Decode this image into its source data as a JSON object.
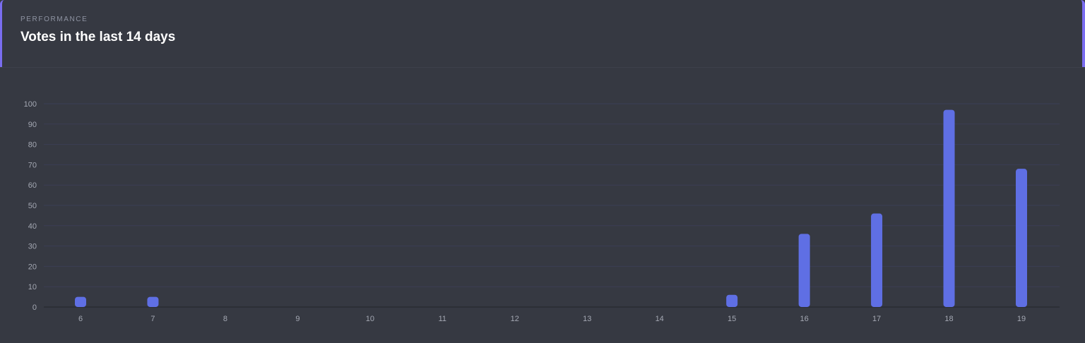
{
  "header": {
    "eyebrow": "PERFORMANCE",
    "title": "Votes in the last 14 days"
  },
  "colors": {
    "accent": "#7a6df0",
    "bar": "#5f6fe4",
    "grid": "#3b3e55",
    "card": "#363942"
  },
  "chart_data": {
    "type": "bar",
    "title": "Votes in the last 14 days",
    "xlabel": "",
    "ylabel": "",
    "categories": [
      "6",
      "7",
      "8",
      "9",
      "10",
      "11",
      "12",
      "13",
      "14",
      "15",
      "16",
      "17",
      "18",
      "19"
    ],
    "values": [
      5,
      5,
      0,
      0,
      0,
      0,
      0,
      0,
      0,
      6,
      36,
      46,
      97,
      68
    ],
    "ylim": [
      0,
      100
    ],
    "yticks": [
      0,
      10,
      20,
      30,
      40,
      50,
      60,
      70,
      80,
      90,
      100
    ],
    "grid": true,
    "legend": "none"
  }
}
